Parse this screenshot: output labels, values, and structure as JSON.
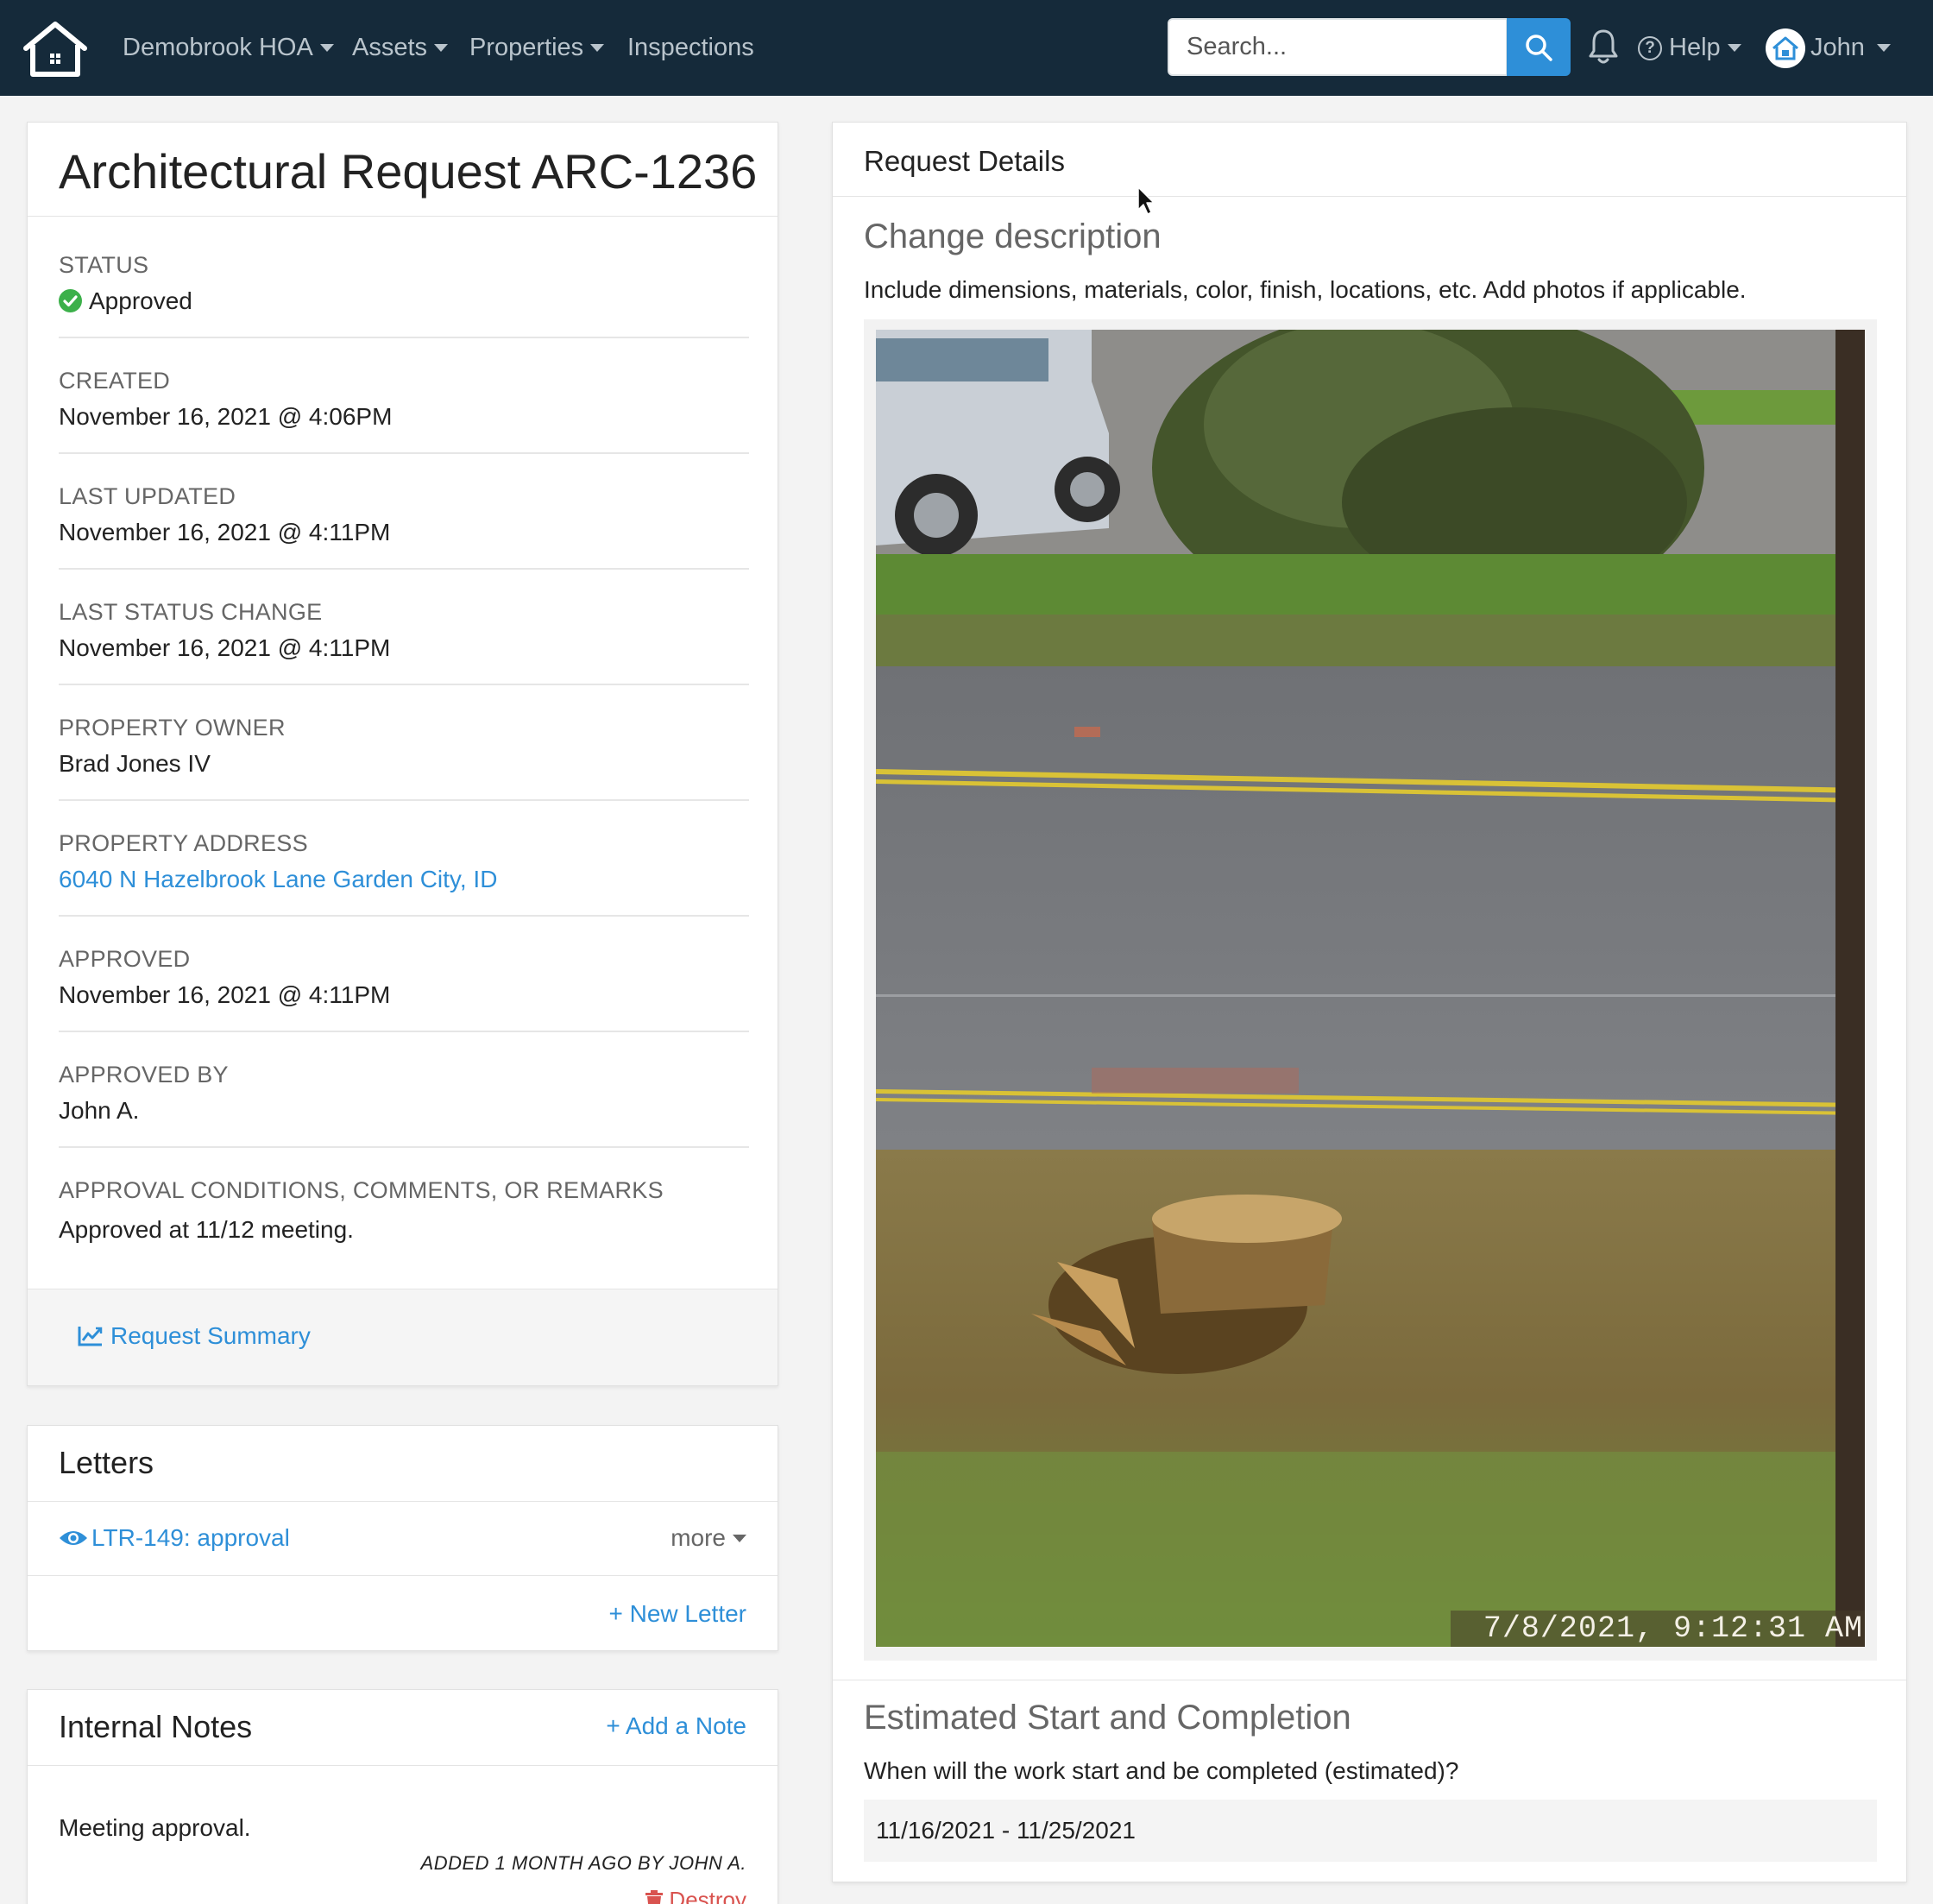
{
  "nav": {
    "org": "Demobrook HOA",
    "assets": "Assets",
    "properties": "Properties",
    "inspections": "Inspections",
    "search_placeholder": "Search...",
    "help": "Help",
    "user": "John"
  },
  "request": {
    "title": "Architectural Request ARC-1236",
    "fields": [
      {
        "label": "STATUS",
        "value": "Approved"
      },
      {
        "label": "CREATED",
        "value": "November 16, 2021 @ 4:06PM"
      },
      {
        "label": "LAST UPDATED",
        "value": "November 16, 2021 @ 4:11PM"
      },
      {
        "label": "LAST STATUS CHANGE",
        "value": "November 16, 2021 @ 4:11PM"
      },
      {
        "label": "PROPERTY OWNER",
        "value": "Brad Jones IV"
      },
      {
        "label": "PROPERTY ADDRESS",
        "value": "6040 N Hazelbrook Lane Garden City, ID"
      },
      {
        "label": "APPROVED",
        "value": "November 16, 2021 @ 4:11PM"
      },
      {
        "label": "APPROVED BY",
        "value": "John A."
      },
      {
        "label": "APPROVAL CONDITIONS, COMMENTS, OR REMARKS",
        "value": "Approved at 11/12 meeting."
      }
    ],
    "summary_link": "Request Summary"
  },
  "letters": {
    "title": "Letters",
    "items": [
      {
        "label": "LTR-149: approval"
      }
    ],
    "more": "more",
    "new_letter": "+ New Letter"
  },
  "notes": {
    "title": "Internal Notes",
    "add_note": "+ Add a Note",
    "items": [
      {
        "text": "Meeting approval.",
        "meta": "ADDED 1 MONTH AGO BY JOHN A.",
        "destroy": "Destroy"
      }
    ]
  },
  "details": {
    "title": "Request Details",
    "change": {
      "title": "Change description",
      "help": "Include dimensions, materials, color, finish, locations, etc. Add photos if applicable.",
      "photo_timestamp": "7/8/2021, 9:12:31 AM"
    },
    "estimate": {
      "title": "Estimated Start and Completion",
      "help": "When will the work start and be completed (estimated)?",
      "value": "11/16/2021 - 11/25/2021"
    }
  },
  "colors": {
    "navbar": "#152a3a",
    "accent": "#2e8fd8",
    "approved": "#3cb04a",
    "danger": "#d9534f"
  }
}
